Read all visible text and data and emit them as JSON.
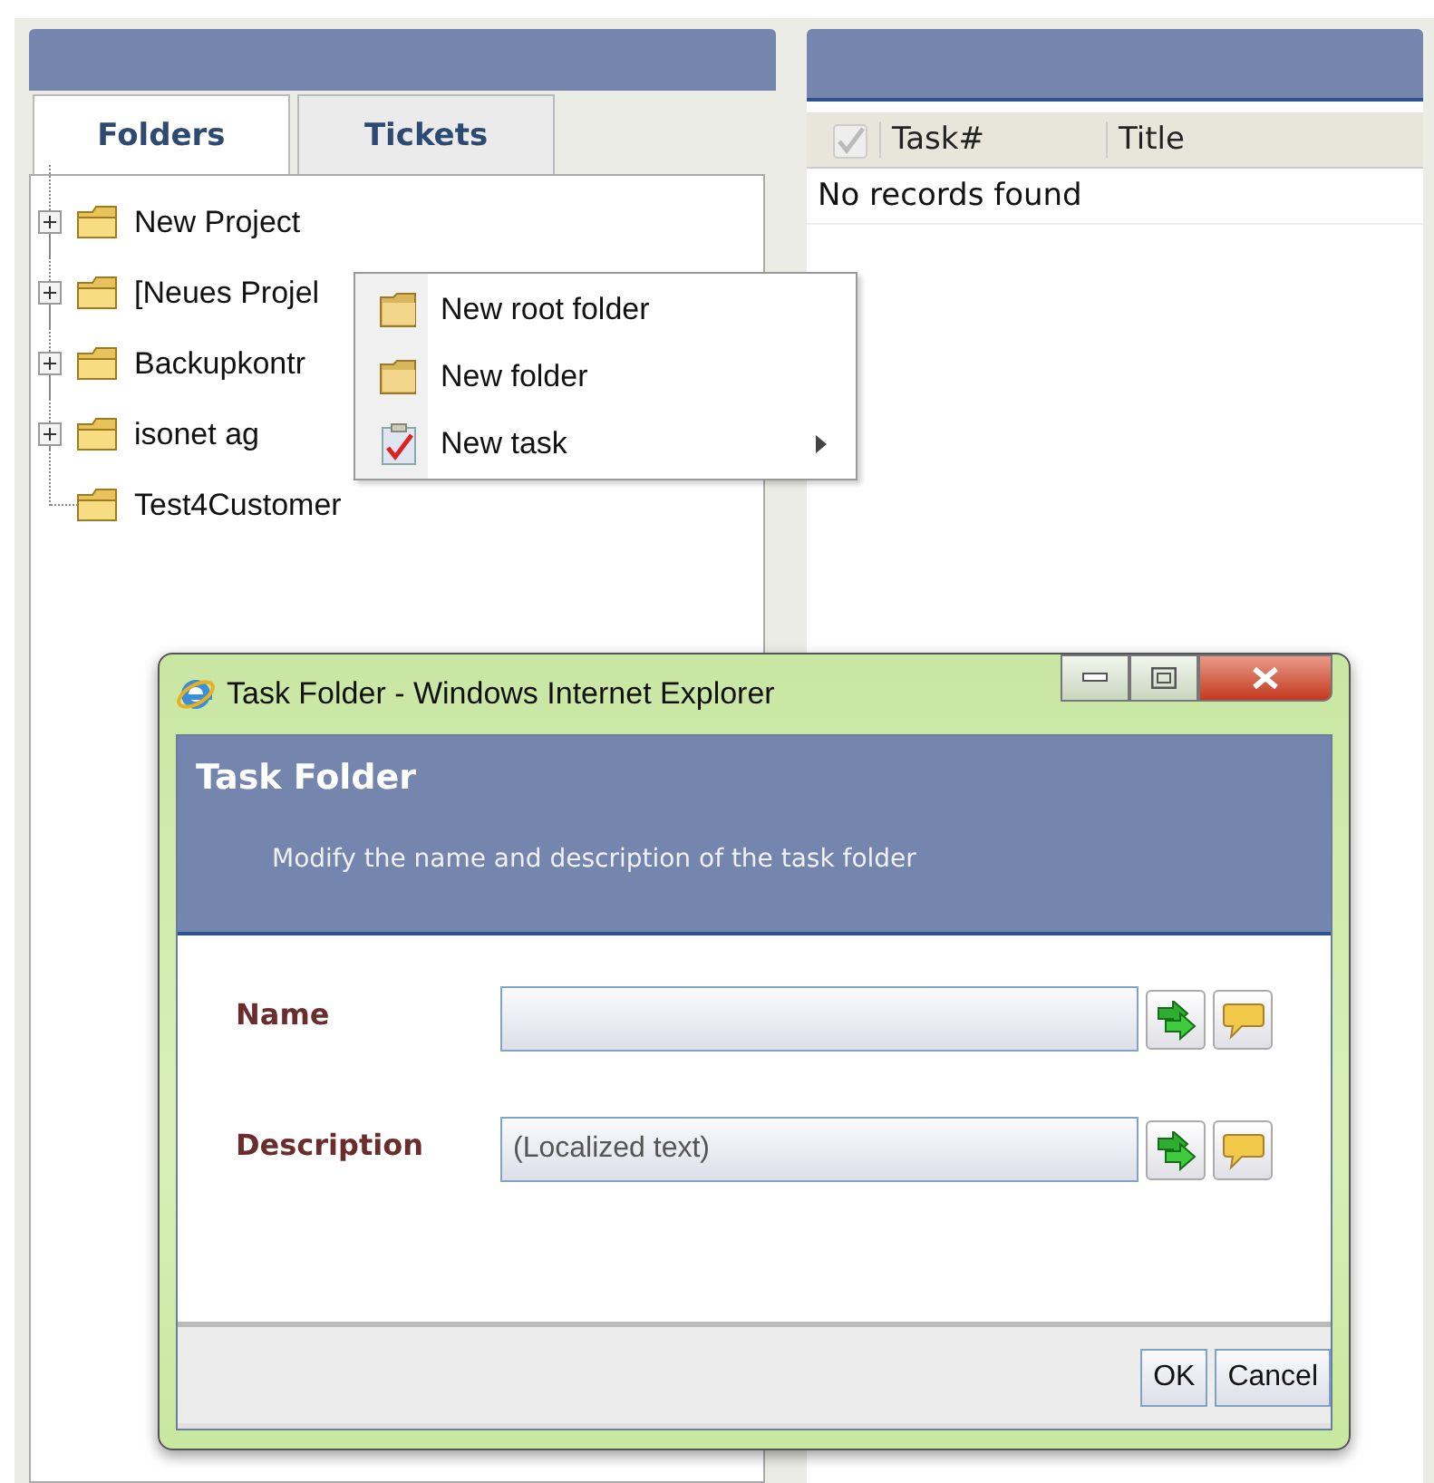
{
  "left_panel": {
    "tabs": [
      {
        "label": "Folders",
        "selected": true
      },
      {
        "label": "Tickets",
        "selected": false
      }
    ],
    "tree": [
      {
        "label": "New Project",
        "kind": "branch"
      },
      {
        "label": "[Neues Projel",
        "kind": "branch"
      },
      {
        "label": "Backupkontr",
        "kind": "branch"
      },
      {
        "label": "isonet ag",
        "kind": "branch"
      },
      {
        "label": "Test4Customer",
        "kind": "leaf"
      }
    ]
  },
  "right_panel": {
    "columns": [
      "Task#",
      "Title"
    ],
    "empty_text": "No records found"
  },
  "context_menu": [
    {
      "label": "New root folder",
      "kind": "folder",
      "has_submenu": false
    },
    {
      "label": "New folder",
      "kind": "folder",
      "has_submenu": false
    },
    {
      "label": "New task",
      "kind": "task",
      "has_submenu": true
    }
  ],
  "dialog": {
    "window_title": "Task Folder - Windows Internet Explorer",
    "title": "Task Folder",
    "subtitle": "Modify the name and description of the task folder",
    "fields": [
      {
        "label": "Name"
      },
      {
        "label": "Description",
        "value": "(Localized text)"
      }
    ],
    "buttons": [
      "OK",
      "Cancel"
    ]
  }
}
